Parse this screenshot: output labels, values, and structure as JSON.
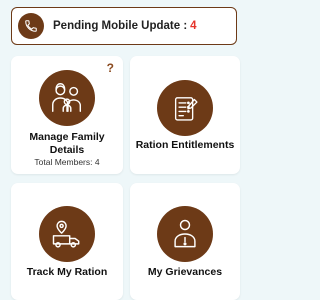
{
  "banner": {
    "label": "Pending Mobile Update :",
    "count": "4",
    "icon": "phone-icon"
  },
  "cards": [
    {
      "title_line1": "Manage Family",
      "title_line2": "Details",
      "subtitle": "Total Members: 4",
      "help": "?",
      "icon": "family-icon"
    },
    {
      "title": "Ration Entitlements",
      "icon": "ration-list-icon"
    },
    {
      "title": "Track My Ration",
      "icon": "delivery-truck-icon"
    },
    {
      "title": "My Grievances",
      "icon": "grievance-person-icon"
    }
  ],
  "colors": {
    "primary": "#6d3a17",
    "accent_count": "#e5332a",
    "background": "#eef7f9",
    "card": "#ffffff"
  }
}
